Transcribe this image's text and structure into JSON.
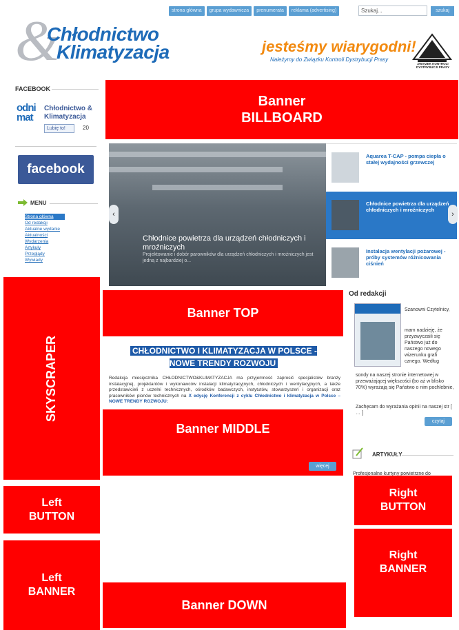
{
  "topnav": {
    "items": [
      "strona główna",
      "grupa wydawnicza",
      "prenumerata",
      "reklama (advertising)"
    ],
    "search_placeholder": "Szukaj...",
    "search_button": "szukaj"
  },
  "logo": {
    "amp": "&",
    "line1": "Chłodnictwo",
    "line2": "Klimatyzacja"
  },
  "promo": {
    "slogan": "jesteśmy wiarygodni!",
    "subtitle": "Należymy do Związku Kontroli Dystrybucji Prasy",
    "zkdp": "ZWIĄZEK KONTROLI DYSTRYBUCJI PRASY"
  },
  "facebook": {
    "heading": "FACEBOOK",
    "logo_text": "odni mat",
    "page_name": "Chłodnictwo & Klimatyzacja",
    "like_label": "Lubię to!",
    "like_count": "20",
    "big_label": "facebook"
  },
  "menu": {
    "heading": "MENU",
    "items": [
      "Strona główna",
      "Od redakcji",
      "Aktualne wydanie",
      "Aktualności",
      "Wydarzenia",
      "Artykuły",
      "Przeglądy",
      "Wywiady"
    ]
  },
  "banners": {
    "billboard": "Banner BILLBOARD",
    "top": "Banner TOP",
    "middle": "Banner MIDDLE",
    "down": "Banner DOWN",
    "skyscraper": "SKYSCRAPER",
    "left_button": "Left BUTTON",
    "left_banner": "Left BANNER",
    "right_button": "Right BUTTON",
    "right_banner": "Right BANNER"
  },
  "slider": {
    "caption": "Chłodnice powietrza dla urządzeń chłodniczych i mroźniczych",
    "subcaption": "Projektowanie i dobór parowników dla urządzeń chłodniczych i mroźniczych jest jedną z najbardziej o...",
    "items": [
      "Aquarea T-CAP - pompa ciepła o stałej wydajności grzewczej",
      "Chłodnice powietrza dla urządzeń chłodniczych i mroźniczych",
      "Instalacja wentylacji pożarowej - próby systemów różnicowania ciśnień"
    ],
    "prev": "‹",
    "next": "›"
  },
  "article": {
    "title": "CHŁODNICTWO I KLIMATYZACJA W POLSCE - NOWE TRENDY ROZWOJU",
    "body": "Redakcja miesięcznika CHŁODNICTWO&KLIMATYZACJA ma przyjemność zaprosić specjalistów branży instalacyjnej, projektantów i wykonawców instalacji klimatyzacyjnych, chłodniczych i wentylacyjnych, a także przedstawicieli z uczelni technicznych, ośrodków badawczych, instytutów, stowarzyszeń i organizacji oraz pracowników pionów technicznych na",
    "body_bold": "X edycję Konferencji z cyklu Chłodnictwo i klimatyzacja w Polsce – NOWE TRENDY ROZWOJU:",
    "more": "więcej"
  },
  "od_redakcji": {
    "heading": "Od redakcji",
    "p1": "Szanowni Czytelnicy,",
    "p2": "mam nadzieję, że przyzwyczaili się Państwo już do naszego nowego wizerunku grafi cznego. Według",
    "p3": "sondy na naszej stronie internetowej w przeważającej większości (bo aż w blisko 70%) wyrażają się Państwo o nim pochlebnie,",
    "p4": "Zachęcam do wyrażania opinii na naszej str [ … ]",
    "button": "czytaj"
  },
  "artykuly": {
    "heading": "ARTYKUŁY",
    "text": "Profesjonalne kurtyny powietrzne do"
  },
  "colors": {
    "banner": "#ff0000",
    "brand_blue": "#1e6bb8",
    "accent_orange": "#f28a10",
    "facebook": "#3b5998"
  }
}
